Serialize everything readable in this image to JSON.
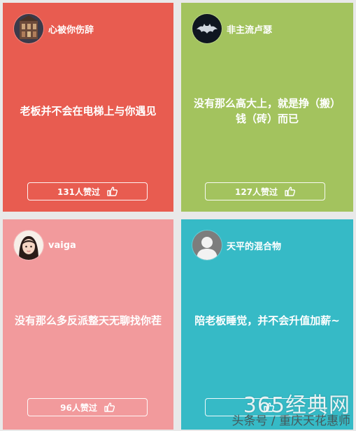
{
  "cards": [
    {
      "username": "心被你伤辞",
      "quote": "老板并不会在电梯上与你遇见",
      "likes": "131人赞过",
      "bg_color": "#e85c50",
      "avatar_icon": "photo-avatar"
    },
    {
      "username": "非主流卢瑟",
      "quote": "没有那么高大上，就是挣（搬）钱（砖）而已",
      "likes": "127人赞过",
      "bg_color": "#a3c35e",
      "avatar_icon": "batman-logo-avatar"
    },
    {
      "username": "vaiga",
      "quote": "没有那么多反派整天无聊找你茬",
      "likes": "96人赞过",
      "bg_color": "#f29a9c",
      "avatar_icon": "girl-photo-avatar"
    },
    {
      "username": "天平的混合物",
      "quote": "陪老板睡觉，并不会升值加薪~",
      "likes": "",
      "bg_color": "#36bac6",
      "avatar_icon": "default-user-avatar"
    }
  ],
  "watermark": {
    "title": "365经典网",
    "subtitle": "头条号 / 重庆天花惠师"
  },
  "colors": {
    "page_background": "#e9e9e9",
    "text": "#ffffff"
  }
}
